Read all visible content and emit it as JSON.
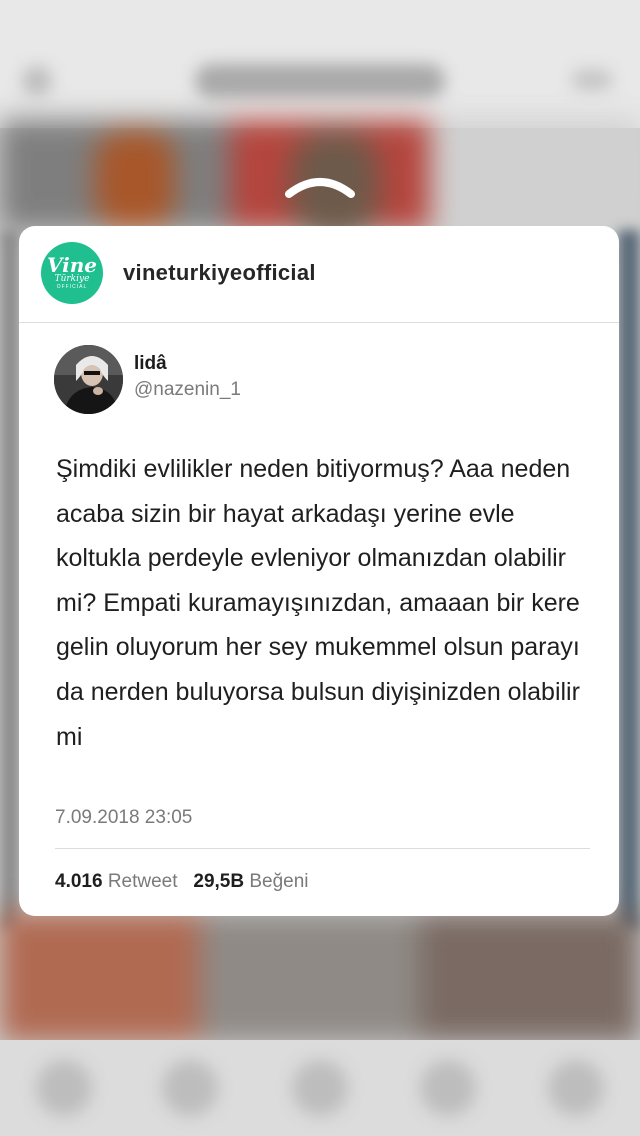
{
  "account": {
    "name": "vineturkiyeofficial",
    "avatar_logo": {
      "word": "Vine",
      "sub": "Türkiye",
      "tag": "OFFICIAL",
      "color": "#1fbf8f"
    }
  },
  "tweet": {
    "author_name": "lidâ",
    "author_handle": "@nazenin_1",
    "text": "Şimdiki evlilikler neden bitiyormuş? Aaa neden acaba sizin bir hayat arkadaşı yerine evle koltukla perdeyle evleniyor olmanızdan olabilir mi? Empati kuramayışınızdan, amaaan bir kere gelin oluyorum her sey mukemmel olsun parayı da nerden buluyorsa bulsun diyişinizden olabilir mi",
    "timestamp": "7.09.2018 23:05",
    "retweet_count": "4.016",
    "retweet_label": "Retweet",
    "like_count": "29,5B",
    "like_label": "Beğeni"
  },
  "icons": {
    "dismiss": "chevron-up-icon"
  }
}
